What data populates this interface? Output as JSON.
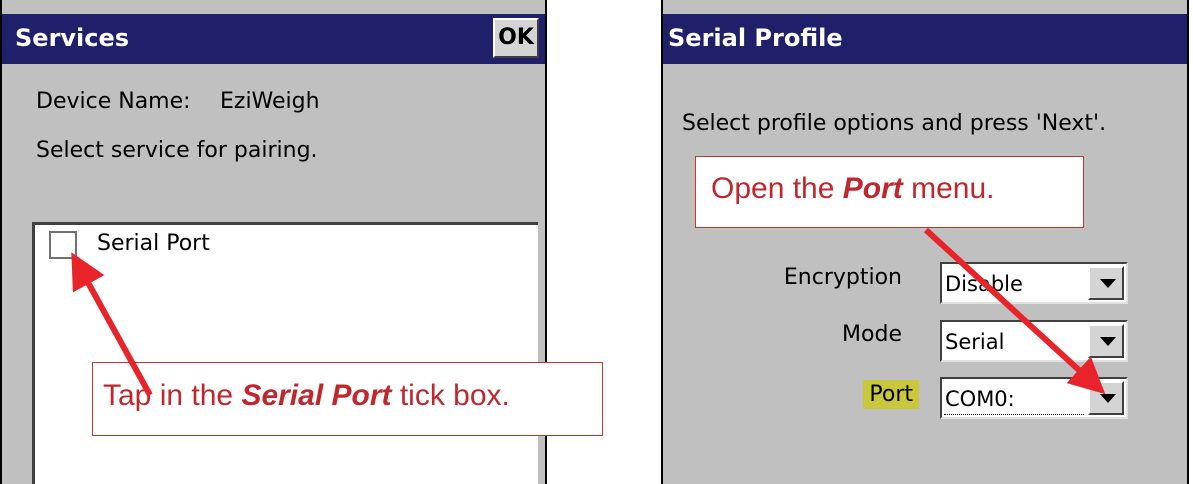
{
  "services_window": {
    "title": "Services",
    "ok_label": "OK",
    "device_name_label": "Device Name:",
    "device_name_value": "EziWeigh",
    "instruction": "Select service for pairing.",
    "services": [
      {
        "label": "Serial Port",
        "checked": false
      }
    ]
  },
  "serial_profile_window": {
    "title": "Serial Profile",
    "instruction": "Select profile options and press 'Next'.",
    "encryption": {
      "label": "Encryption",
      "value": "Disable"
    },
    "mode": {
      "label": "Mode",
      "value": "Serial"
    },
    "port": {
      "label": "Port",
      "value": "COM0:"
    }
  },
  "annotations": {
    "left_callout": {
      "prefix": "Tap in the ",
      "highlight": "Serial Port",
      "suffix": " tick box."
    },
    "right_callout": {
      "prefix": "Open the ",
      "highlight": "Port",
      "suffix": " menu."
    },
    "color": "#e8232a"
  }
}
